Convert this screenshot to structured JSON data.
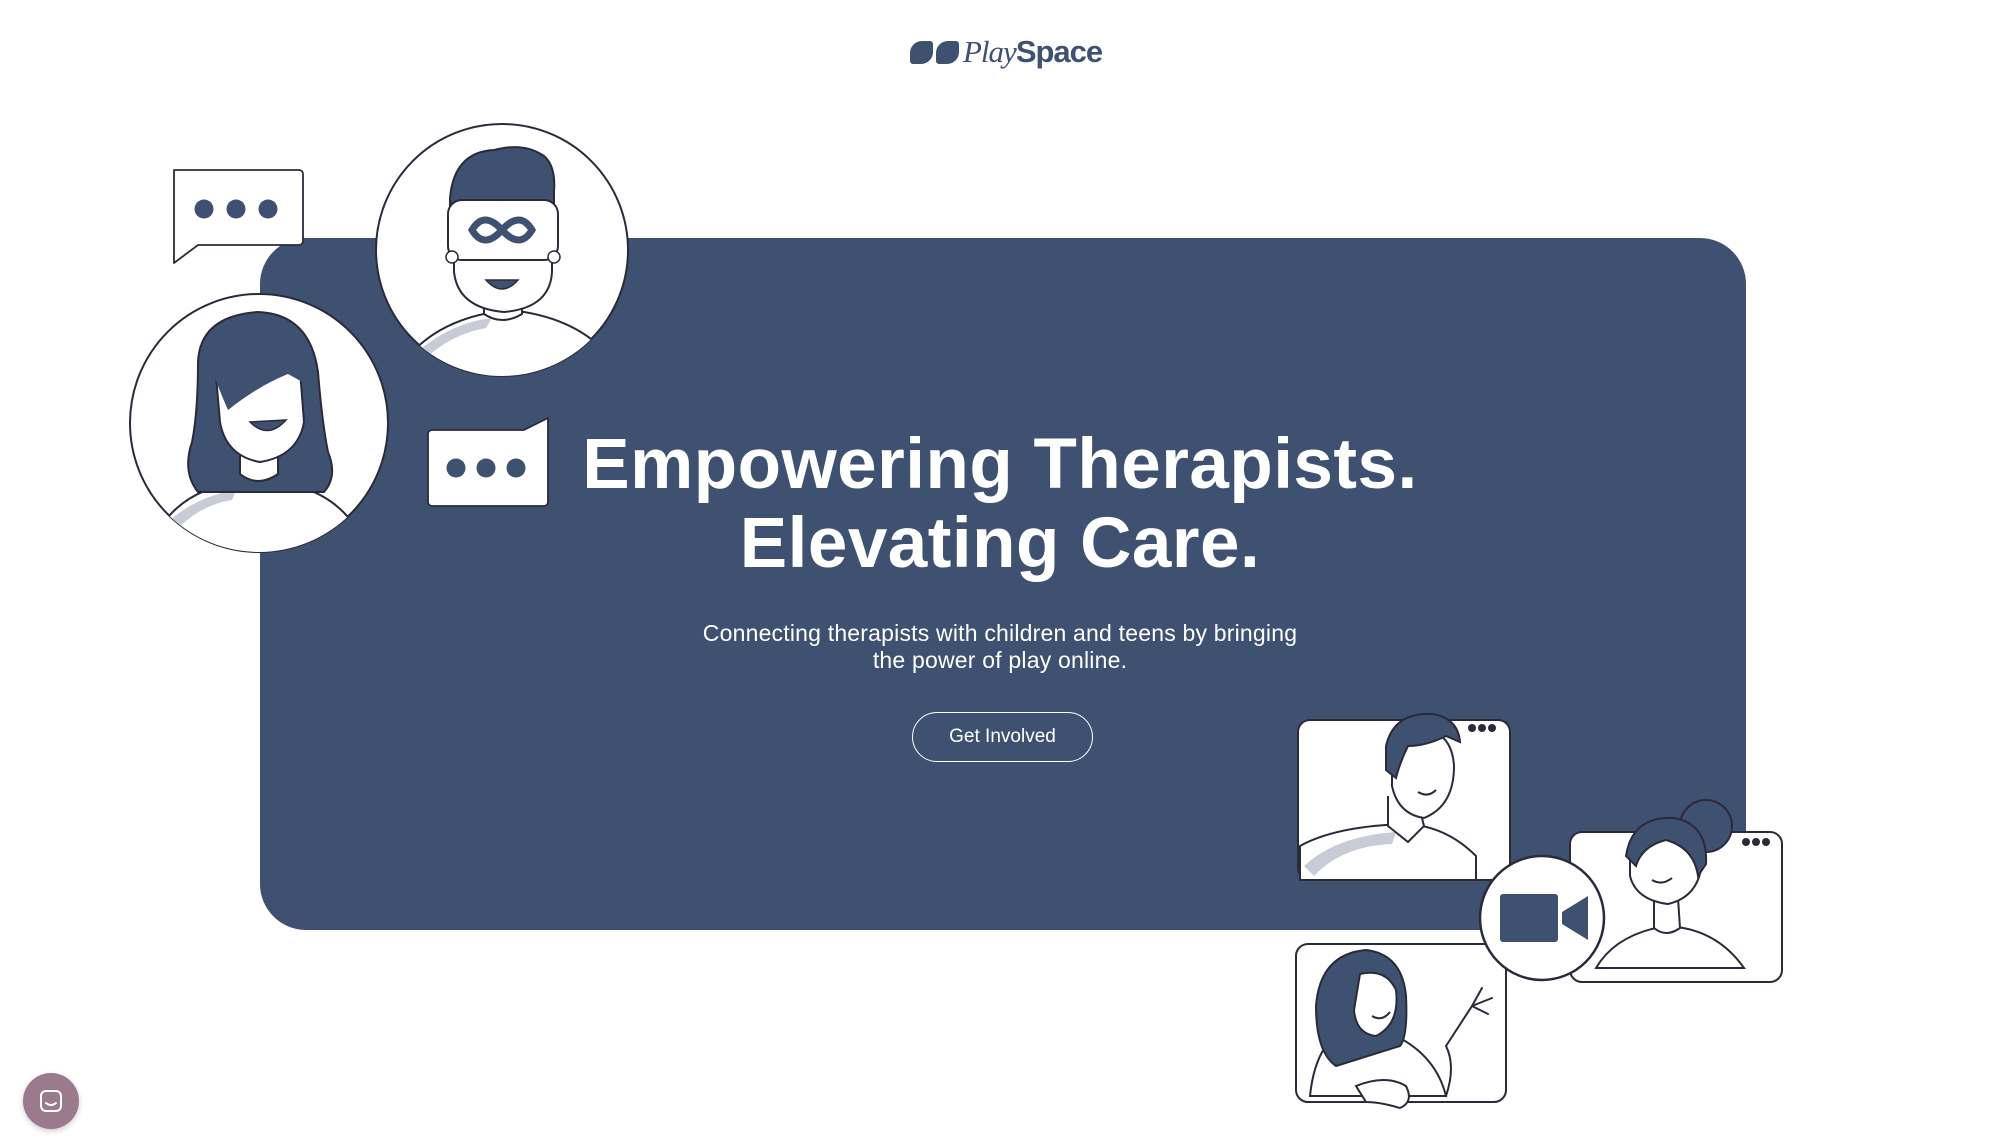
{
  "brand": {
    "name_italic": "Play",
    "name_regular": "Space"
  },
  "hero": {
    "title_line1": "Empowering Therapists.",
    "title_line2": "Elevating Care.",
    "subtitle_line1": "Connecting therapists with children and teens by bringing",
    "subtitle_line2": "the power of play online.",
    "cta_label": "Get Involved"
  },
  "colors": {
    "brand_navy": "#3f5171",
    "background": "#ffffff",
    "launcher": "#9a7a8c"
  },
  "icons": {
    "logo": "playspace-logo-icon",
    "chat_launcher": "chat-launcher-icon",
    "video_camera": "video-camera-icon",
    "vr_headset": "vr-headset-icon"
  }
}
